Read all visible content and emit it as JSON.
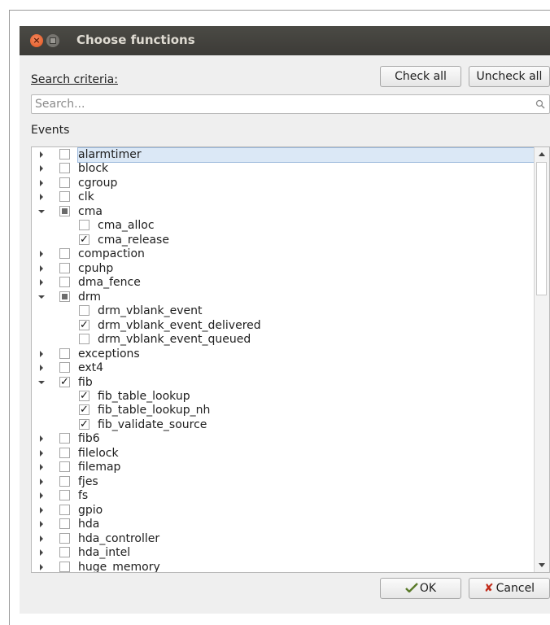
{
  "window": {
    "title": "Choose functions"
  },
  "labels": {
    "search_criteria": "Search criteria:",
    "events": "Events"
  },
  "buttons": {
    "check_all": "Check all",
    "uncheck_all": "Uncheck all",
    "ok": "OK",
    "cancel": "Cancel"
  },
  "search": {
    "placeholder": "Search..."
  },
  "tree": [
    {
      "label": "alarmtimer",
      "level": 0,
      "expand": "closed",
      "check": "none",
      "selected": true
    },
    {
      "label": "block",
      "level": 0,
      "expand": "closed",
      "check": "none"
    },
    {
      "label": "cgroup",
      "level": 0,
      "expand": "closed",
      "check": "none"
    },
    {
      "label": "clk",
      "level": 0,
      "expand": "closed",
      "check": "none"
    },
    {
      "label": "cma",
      "level": 0,
      "expand": "open",
      "check": "partial"
    },
    {
      "label": "cma_alloc",
      "level": 1,
      "expand": "",
      "check": "none"
    },
    {
      "label": "cma_release",
      "level": 1,
      "expand": "",
      "check": "checked"
    },
    {
      "label": "compaction",
      "level": 0,
      "expand": "closed",
      "check": "none"
    },
    {
      "label": "cpuhp",
      "level": 0,
      "expand": "closed",
      "check": "none"
    },
    {
      "label": "dma_fence",
      "level": 0,
      "expand": "closed",
      "check": "none"
    },
    {
      "label": "drm",
      "level": 0,
      "expand": "open",
      "check": "partial"
    },
    {
      "label": "drm_vblank_event",
      "level": 1,
      "expand": "",
      "check": "none"
    },
    {
      "label": "drm_vblank_event_delivered",
      "level": 1,
      "expand": "",
      "check": "checked"
    },
    {
      "label": "drm_vblank_event_queued",
      "level": 1,
      "expand": "",
      "check": "none"
    },
    {
      "label": "exceptions",
      "level": 0,
      "expand": "closed",
      "check": "none"
    },
    {
      "label": "ext4",
      "level": 0,
      "expand": "closed",
      "check": "none"
    },
    {
      "label": "fib",
      "level": 0,
      "expand": "open",
      "check": "checked"
    },
    {
      "label": "fib_table_lookup",
      "level": 1,
      "expand": "",
      "check": "checked"
    },
    {
      "label": "fib_table_lookup_nh",
      "level": 1,
      "expand": "",
      "check": "checked"
    },
    {
      "label": "fib_validate_source",
      "level": 1,
      "expand": "",
      "check": "checked"
    },
    {
      "label": "fib6",
      "level": 0,
      "expand": "closed",
      "check": "none"
    },
    {
      "label": "filelock",
      "level": 0,
      "expand": "closed",
      "check": "none"
    },
    {
      "label": "filemap",
      "level": 0,
      "expand": "closed",
      "check": "none"
    },
    {
      "label": "fjes",
      "level": 0,
      "expand": "closed",
      "check": "none"
    },
    {
      "label": "fs",
      "level": 0,
      "expand": "closed",
      "check": "none"
    },
    {
      "label": "gpio",
      "level": 0,
      "expand": "closed",
      "check": "none"
    },
    {
      "label": "hda",
      "level": 0,
      "expand": "closed",
      "check": "none"
    },
    {
      "label": "hda_controller",
      "level": 0,
      "expand": "closed",
      "check": "none"
    },
    {
      "label": "hda_intel",
      "level": 0,
      "expand": "closed",
      "check": "none"
    },
    {
      "label": "huge_memory",
      "level": 0,
      "expand": "closed",
      "check": "none"
    }
  ],
  "colors": {
    "titlebar": "#3c3b37",
    "selection": "#dbe8f6",
    "close_button": "#e2541c",
    "cancel_x": "#c22b1a"
  },
  "icons": {
    "ok": "ok-check-icon",
    "cancel": "cancel-x-icon",
    "search": "search-icon"
  }
}
